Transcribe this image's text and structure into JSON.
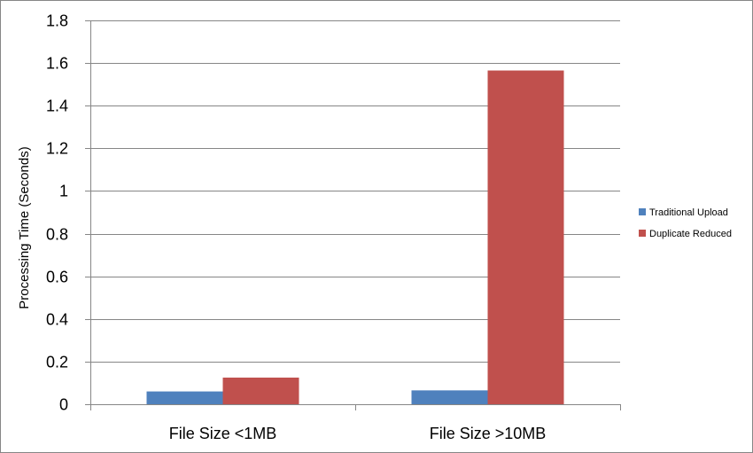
{
  "chart_data": {
    "type": "bar",
    "title": "",
    "xlabel": "",
    "ylabel": "Processing Time (Seconds)",
    "categories": [
      "File Size <1MB",
      "File Size >10MB"
    ],
    "series": [
      {
        "name": "Traditional Upload",
        "values": [
          0.06,
          0.065
        ],
        "color": "#4f81bd"
      },
      {
        "name": "Duplicate Reduced",
        "values": [
          0.125,
          1.565
        ],
        "color": "#c0504d"
      }
    ],
    "ylim": [
      0,
      1.8
    ],
    "yticks": [
      "0",
      "0.2",
      "0.4",
      "0.6",
      "0.8",
      "1",
      "1.2",
      "1.4",
      "1.6",
      "1.8"
    ],
    "grid": true,
    "legend_position": "right"
  },
  "colors": {
    "gridline": "#868686",
    "axis": "#868686"
  }
}
